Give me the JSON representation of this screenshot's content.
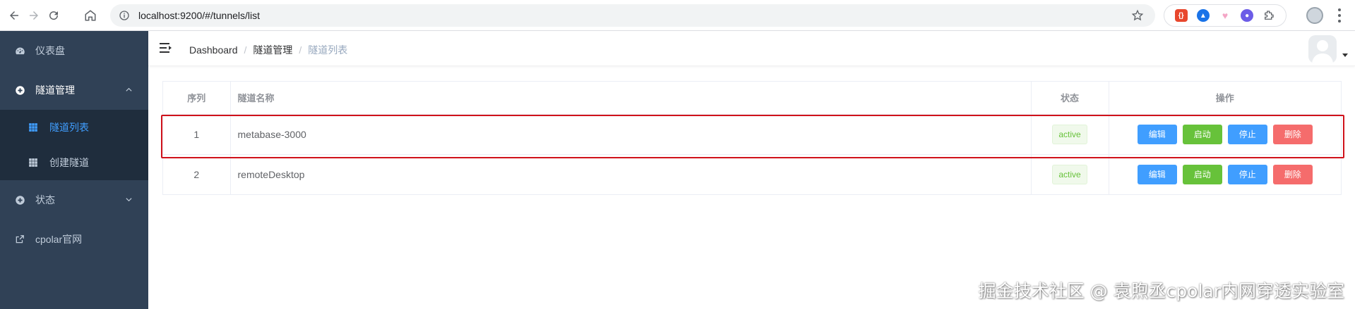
{
  "browser": {
    "url": "localhost:9200/#/tunnels/list",
    "extensions": [
      {
        "icon": "ext-red-icon",
        "color": "#e8472d"
      },
      {
        "icon": "ext-blue-icon",
        "color": "#1a73e8"
      },
      {
        "icon": "ext-pink-icon",
        "color": "#f4a6c6"
      },
      {
        "icon": "ext-purple-icon",
        "color": "#6c5ce7"
      }
    ]
  },
  "sidebar": {
    "items": [
      {
        "label": "仪表盘",
        "icon": "dashboard-icon"
      },
      {
        "label": "隧道管理",
        "icon": "plus-circle-icon",
        "expanded": true,
        "children": [
          {
            "label": "隧道列表",
            "icon": "grid-icon",
            "active": true
          },
          {
            "label": "创建隧道",
            "icon": "grid-icon",
            "active": false
          }
        ]
      },
      {
        "label": "状态",
        "icon": "plus-circle-icon",
        "expanded": false
      },
      {
        "label": "cpolar官网",
        "icon": "external-link-icon"
      }
    ]
  },
  "navbar": {
    "breadcrumb": [
      "Dashboard",
      "隧道管理",
      "隧道列表"
    ]
  },
  "table": {
    "columns": [
      "序列",
      "隧道名称",
      "状态",
      "操作"
    ],
    "rows": [
      {
        "index": "1",
        "name": "metabase-3000",
        "status": "active"
      },
      {
        "index": "2",
        "name": "remoteDesktop",
        "status": "active"
      }
    ],
    "actions": {
      "edit": "编辑",
      "start": "启动",
      "stop": "停止",
      "delete": "删除"
    }
  },
  "watermark": "掘金技术社区 @ 袁煦丞cpolar内网穿透实验室",
  "colors": {
    "sidebar_bg": "#304156",
    "submenu_bg": "#1f2d3d",
    "active_menu": "#409eff",
    "primary": "#409eff",
    "success": "#67c23a",
    "danger": "#f56c6c",
    "highlight_box": "#d0121b"
  }
}
